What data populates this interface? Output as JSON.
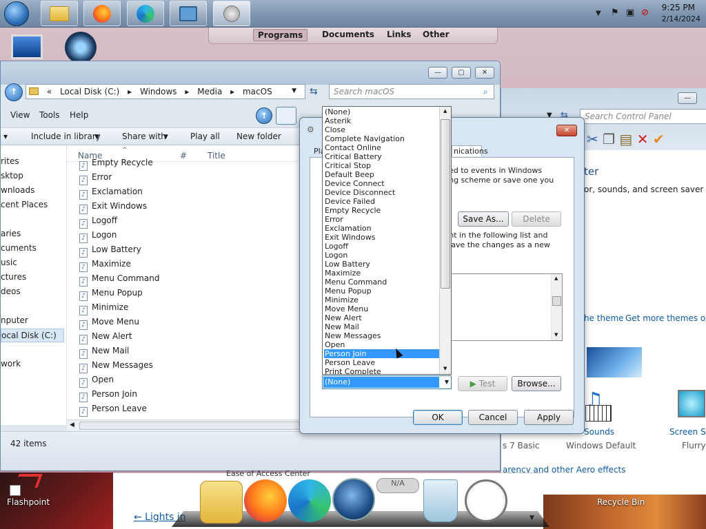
{
  "taskbar": {
    "clock_time": "9:25 PM",
    "clock_date": "2/14/2024",
    "buttons": [
      "start-orb",
      "explorer",
      "firefox",
      "edge",
      "control-panel",
      "sound"
    ]
  },
  "start_tabs": [
    "Programs",
    "Documents",
    "Links",
    "Other"
  ],
  "explorer": {
    "address": [
      "«",
      "Local Disk (C:)",
      "Windows",
      "Media",
      "macOS"
    ],
    "search_placeholder": "Search macOS",
    "menu": [
      "View",
      "Tools",
      "Help"
    ],
    "toolbar": [
      "Include in library",
      "Share with",
      "Play all",
      "New folder"
    ],
    "nav": [
      "rites",
      "sktop",
      "wnloads",
      "cent Places",
      "aries",
      "cuments",
      "usic",
      "ctures",
      "deos",
      "nputer",
      "ocal Disk (C:)",
      "work"
    ],
    "columns": [
      "Name",
      "#",
      "Title"
    ],
    "files": [
      "Empty Recycle",
      "Error",
      "Exclamation",
      "Exit Windows",
      "Logoff",
      "Logon",
      "Low Battery",
      "Maximize",
      "Menu Command",
      "Menu Popup",
      "Minimize",
      "Move Menu",
      "New Alert",
      "New Mail",
      "New Messages",
      "Open",
      "Person Join",
      "Person Leave"
    ],
    "status": "42 items"
  },
  "control_panel": {
    "search_placeholder": "Search Control Panel",
    "heading_fragment": "ter",
    "desc": "or, sounds, and screen saver all at",
    "links": [
      "he theme",
      "Get more themes onli"
    ],
    "items": [
      "Sounds",
      "Windows Default",
      "Screen Sav",
      "Flurry",
      "s 7 Basic"
    ],
    "aero_link": "arency and other Aero effects",
    "ease": "Ease of Access Center",
    "lights": "← Lights in"
  },
  "sound_dialog": {
    "tab_fragment_left": "Pla",
    "tab_fragment_right": "nications",
    "desc1_a": "plied to events in Windows",
    "desc1_b": "sting scheme or save one you",
    "save_as": "Save As...",
    "delete": "Delete",
    "desc2_a": "vent in the following list and",
    "desc2_b": "n save the changes as a new",
    "test": "Test",
    "browse": "Browse...",
    "ok": "OK",
    "cancel": "Cancel",
    "apply": "Apply"
  },
  "sound_dropdown": {
    "options": [
      "(None)",
      "Asterik",
      "Close",
      "Complete Navigation",
      "Contact Online",
      "Critical Battery",
      "Critical Stop",
      "Default Beep",
      "Device Connect",
      "Device Disconnect",
      "Device Failed",
      "Empty Recycle",
      "Error",
      "Exclamation",
      "Exit Windows",
      "Logoff",
      "Logon",
      "Low Battery",
      "Maximize",
      "Menu Command",
      "Menu Popup",
      "Minimize",
      "Move Menu",
      "New Alert",
      "New Mail",
      "New Messages",
      "Open",
      "Person Join",
      "Person Leave",
      "Print Complete"
    ],
    "highlighted": "Person Join",
    "selected": "(None)"
  },
  "desktop": {
    "flashpoint": "Flashpoint",
    "recycle_bin": "Recycle Bin"
  },
  "colors": {
    "selection": "#3399ff",
    "link": "#0d5ba8"
  }
}
